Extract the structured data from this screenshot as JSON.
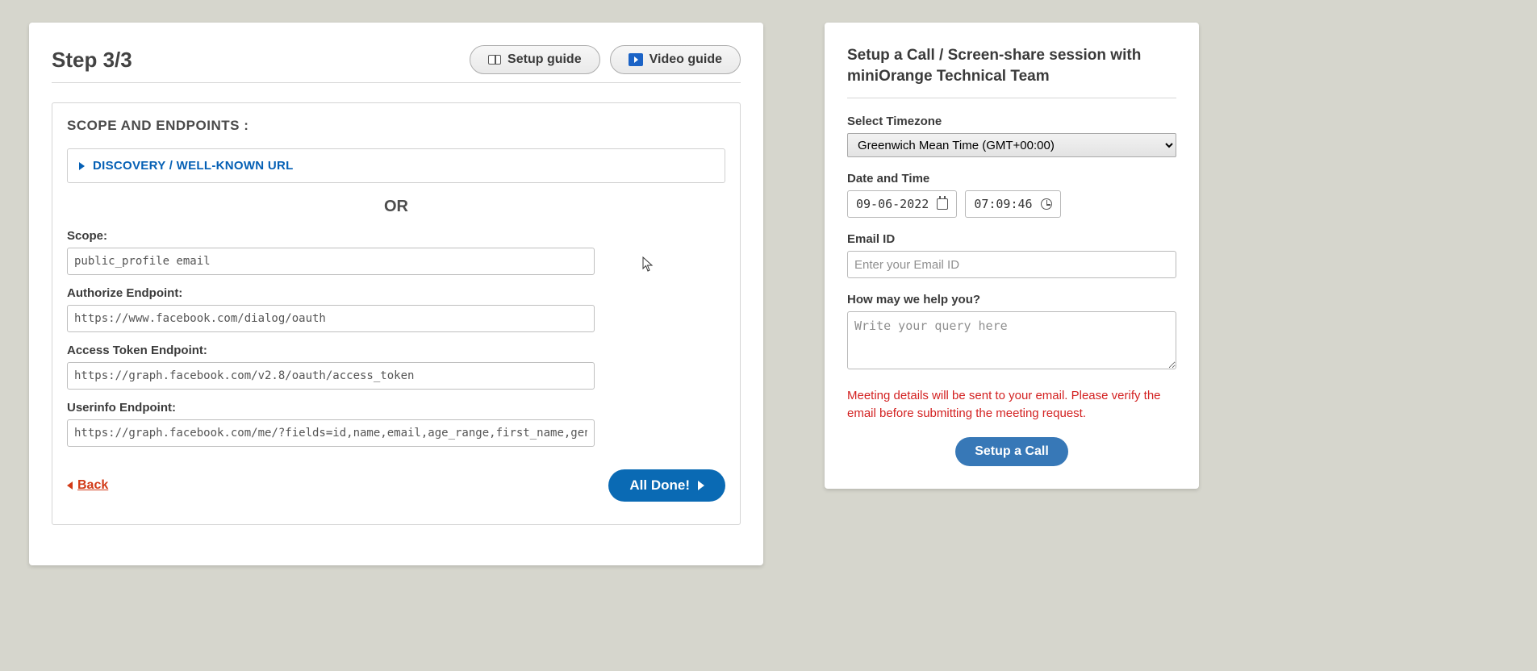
{
  "main": {
    "step_title": "Step 3/3",
    "buttons": {
      "setup_guide": "Setup guide",
      "video_guide": "Video guide"
    },
    "section_title": "SCOPE AND ENDPOINTS :",
    "accordion_label": "DISCOVERY / WELL-KNOWN URL",
    "or_label": "OR",
    "fields": {
      "scope": {
        "label": "Scope:",
        "value": "public_profile email"
      },
      "authorize": {
        "label": "Authorize Endpoint:",
        "value": "https://www.facebook.com/dialog/oauth"
      },
      "token": {
        "label": "Access Token Endpoint:",
        "value": "https://graph.facebook.com/v2.8/oauth/access_token"
      },
      "userinfo": {
        "label": "Userinfo Endpoint:",
        "value": "https://graph.facebook.com/me/?fields=id,name,email,age_range,first_name,gender,last_name,lin"
      }
    },
    "footer": {
      "back_label": "Back",
      "done_label": "All Done!"
    }
  },
  "side": {
    "title": "Setup a Call / Screen-share session with miniOrange Technical Team",
    "timezone": {
      "label": "Select Timezone",
      "value": "Greenwich Mean Time (GMT+00:00)"
    },
    "datetime": {
      "label": "Date and Time",
      "date": "09-06-2022",
      "time": "07:09:46"
    },
    "email": {
      "label": "Email ID",
      "placeholder": "Enter your Email ID"
    },
    "help": {
      "label": "How may we help you?",
      "placeholder": "Write your query here"
    },
    "notice": "Meeting details will be sent to your email. Please verify the email before submitting the meeting request.",
    "button_label": "Setup a Call"
  }
}
